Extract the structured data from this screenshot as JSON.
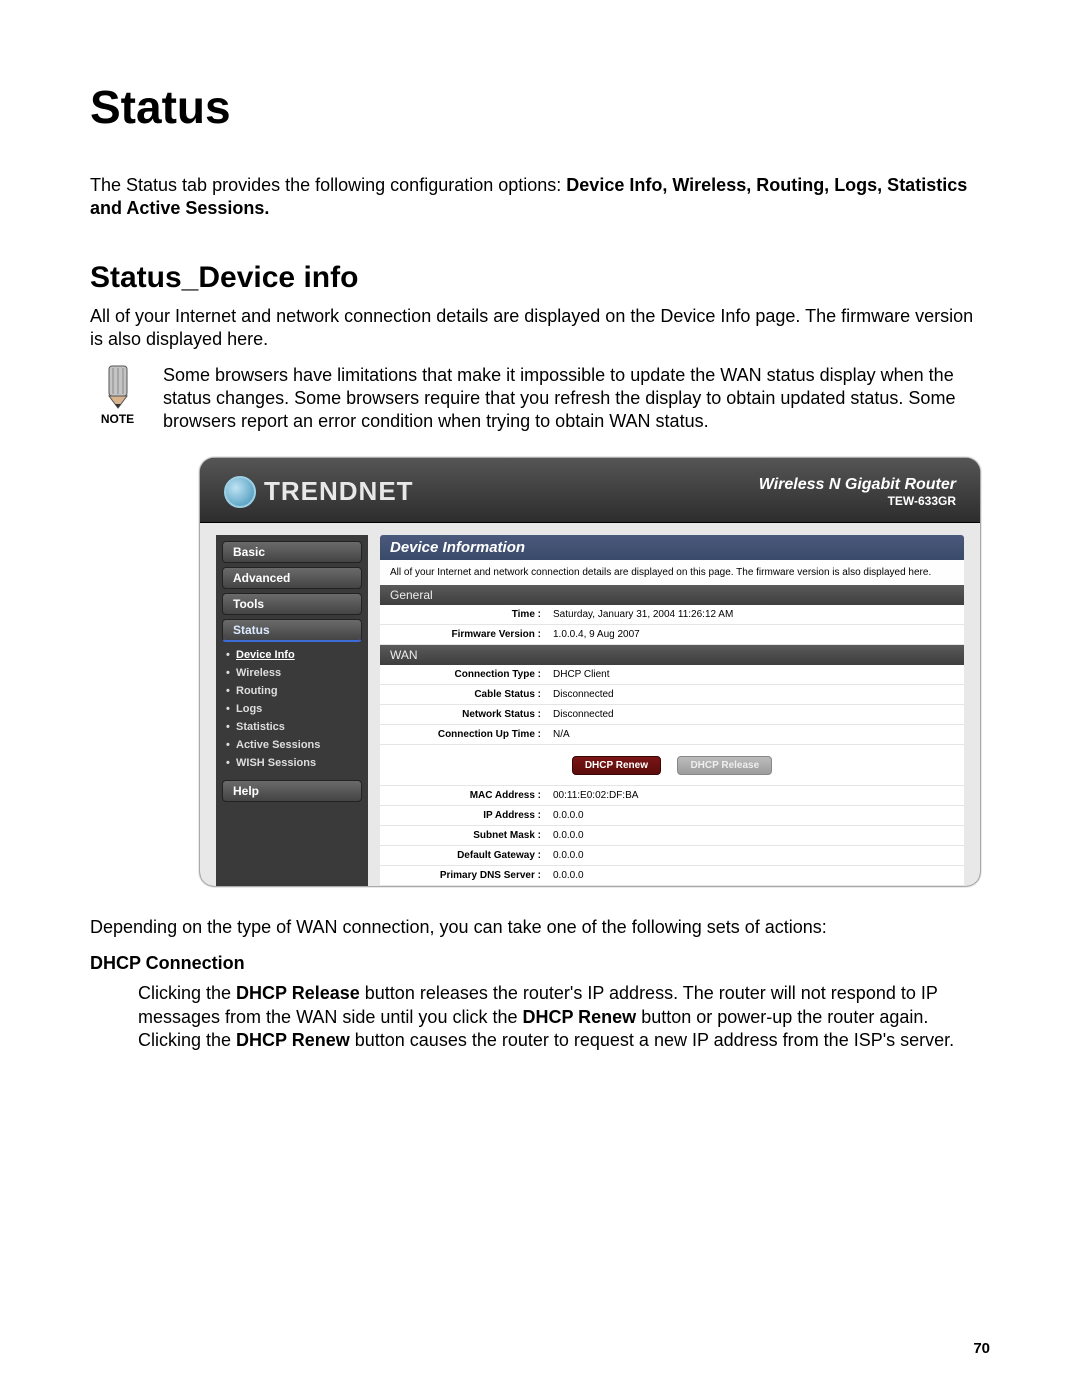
{
  "doc": {
    "title": "Status",
    "intro_prefix": "The Status tab provides the following configuration options: ",
    "intro_bold": "Device Info, Wireless, Routing, Logs, Statistics and Active Sessions.",
    "section_title": "Status_Device info",
    "section_intro": "All of your Internet and network connection details are displayed on the Device Info page. The firmware version is also displayed here.",
    "note_label": "NOTE",
    "note_text": "Some browsers have limitations that make it impossible to update the WAN status display when the status changes. Some browsers require that you refresh the display to obtain updated status. Some browsers report an error condition when trying to obtain WAN status.",
    "after_text": "Depending on the type of WAN connection, you can take one of the following sets of actions:",
    "dhcp_heading": "DHCP Connection",
    "dhcp_body_1": "Clicking the ",
    "dhcp_body_b1": "DHCP Release",
    "dhcp_body_2": " button releases the router's IP address. The router will not respond to IP messages from the WAN side until you click the ",
    "dhcp_body_b2": "DHCP Renew",
    "dhcp_body_3": " button or power-up the router again. Clicking the ",
    "dhcp_body_b3": "DHCP Renew",
    "dhcp_body_4": " button causes the router to request a new IP address from the ISP's server.",
    "page_number": "70"
  },
  "router": {
    "brand": "TRENDNET",
    "title_main": "Wireless N Gigabit Router",
    "title_sub": "TEW-633GR",
    "sidebar": {
      "basic": "Basic",
      "advanced": "Advanced",
      "tools": "Tools",
      "status": "Status",
      "help": "Help",
      "subitems": {
        "device_info": "Device Info",
        "wireless": "Wireless",
        "routing": "Routing",
        "logs": "Logs",
        "statistics": "Statistics",
        "active_sessions": "Active Sessions",
        "wish_sessions": "WISH Sessions"
      }
    },
    "panel": {
      "title": "Device Information",
      "desc": "All of your Internet and network connection details are displayed on this page. The firmware version is also displayed here.",
      "general_heading": "General",
      "general": {
        "time_label": "Time :",
        "time_value": "Saturday, January 31, 2004 11:26:12 AM",
        "fw_label": "Firmware Version :",
        "fw_value": "1.0.0.4,  9 Aug 2007"
      },
      "wan_heading": "WAN",
      "wan": {
        "conn_type_label": "Connection Type :",
        "conn_type_value": "DHCP Client",
        "cable_label": "Cable Status :",
        "cable_value": "Disconnected",
        "net_label": "Network Status :",
        "net_value": "Disconnected",
        "uptime_label": "Connection Up Time :",
        "uptime_value": "N/A",
        "btn_renew": "DHCP Renew",
        "btn_release": "DHCP Release",
        "mac_label": "MAC Address :",
        "mac_value": "00:11:E0:02:DF:BA",
        "ip_label": "IP Address :",
        "ip_value": "0.0.0.0",
        "mask_label": "Subnet Mask :",
        "mask_value": "0.0.0.0",
        "gw_label": "Default Gateway :",
        "gw_value": "0.0.0.0",
        "dns_label": "Primary DNS Server :",
        "dns_value": "0.0.0.0"
      }
    }
  }
}
